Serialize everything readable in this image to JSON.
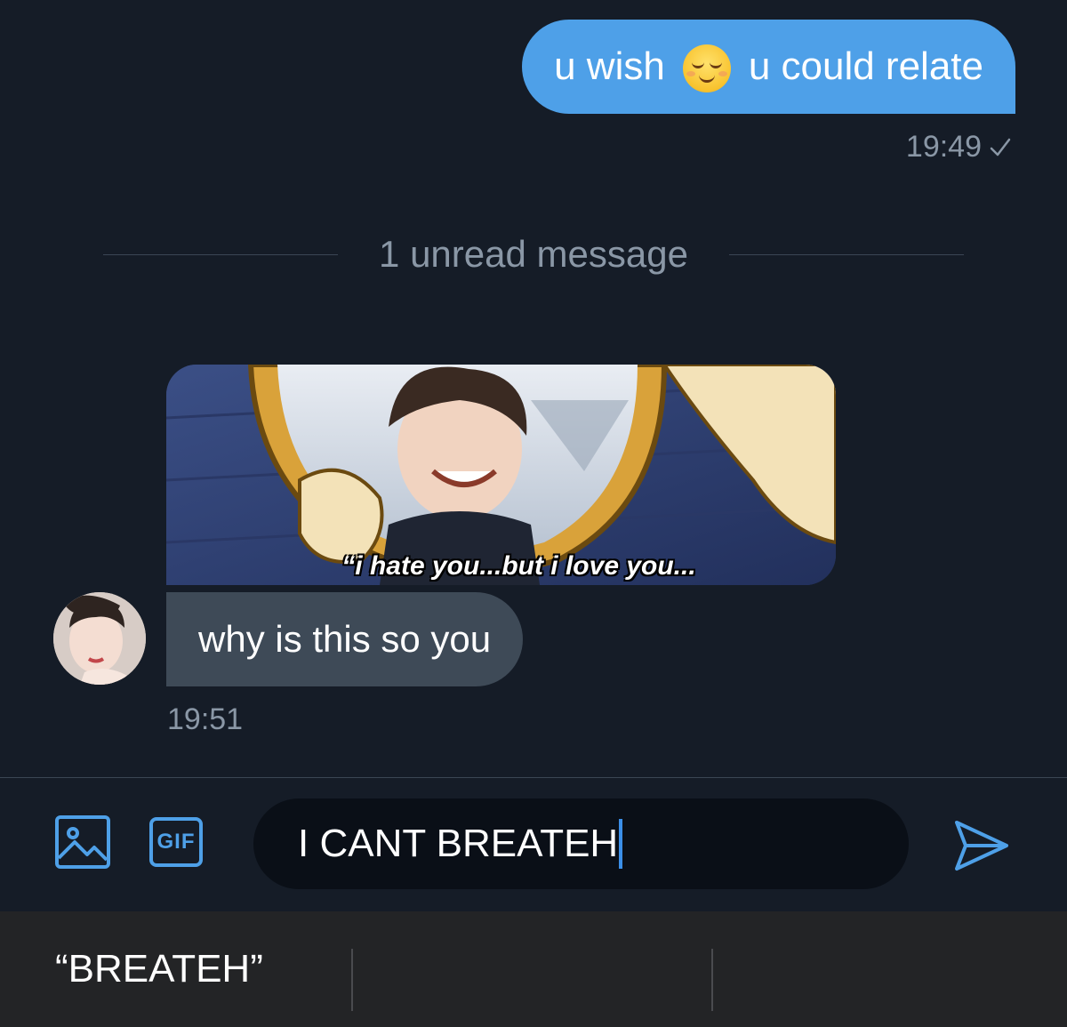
{
  "outgoing": {
    "text_before": "u wish",
    "emoji": "relieved-face",
    "text_after": "u could relate",
    "time": "19:49",
    "status_icon": "check-icon"
  },
  "divider": {
    "label": "1 unread message"
  },
  "incoming": {
    "media_caption": "“i hate you...but i love you...",
    "text": "why is this so you",
    "time": "19:51"
  },
  "composer": {
    "input_value": "I CANT BREATEH",
    "icons": [
      "image-icon",
      "gif-icon",
      "send-icon"
    ],
    "gif_label": "GIF"
  },
  "keyboard": {
    "suggestions": [
      "“BREATEH”",
      "",
      ""
    ]
  },
  "colors": {
    "background": "#151c27",
    "accent": "#4ea0e8",
    "incoming_bubble": "#3e4a57",
    "muted_text": "#8a97a6"
  }
}
